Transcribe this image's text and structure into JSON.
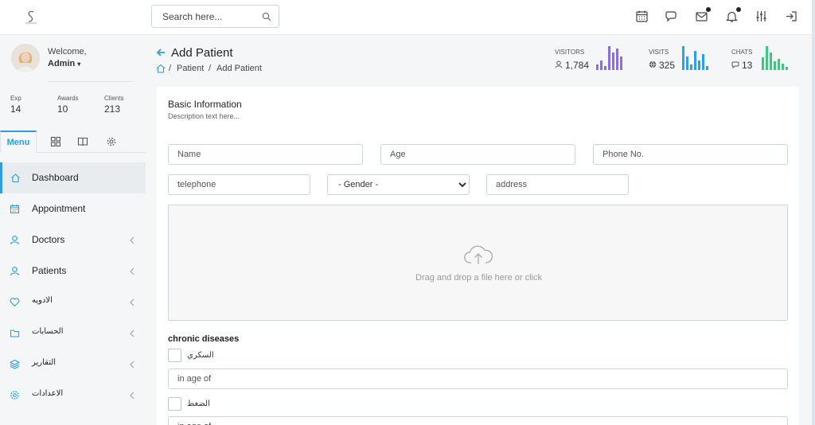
{
  "header": {
    "search_placeholder": "Search here...",
    "icons": [
      "calendar-icon",
      "chat-icon",
      "mail-icon",
      "bell-icon",
      "sliders-icon",
      "logout-icon"
    ]
  },
  "profile": {
    "welcome": "Welcome,",
    "name": "Admin",
    "caret": "▾",
    "stats": [
      {
        "label": "Exp",
        "value": "14"
      },
      {
        "label": "Awards",
        "value": "10"
      },
      {
        "label": "Clients",
        "value": "213"
      }
    ]
  },
  "sidebar": {
    "tab_menu": "Menu",
    "items": [
      {
        "label": "Dashboard",
        "icon": "home-icon",
        "active": true
      },
      {
        "label": "Appointment",
        "icon": "calendar-icon"
      },
      {
        "label": "Doctors",
        "icon": "user-icon"
      },
      {
        "label": "Patients",
        "icon": "user-icon"
      },
      {
        "label": "الادويه",
        "icon": "heart-icon"
      },
      {
        "label": "الحسابات",
        "icon": "folder-icon"
      },
      {
        "label": "التقارير",
        "icon": "layers-icon"
      },
      {
        "label": "الاعدادات",
        "icon": "gear-icon"
      }
    ]
  },
  "page": {
    "title": "Add Patient",
    "breadcrumb": {
      "sep": "/",
      "parent": "Patient",
      "current": "Add Patient"
    },
    "stats": [
      {
        "label": "VISITORS",
        "value": "1,784",
        "color": "#8a6de0"
      },
      {
        "label": "VISITS",
        "value": "325",
        "color": "#2f9fe8"
      },
      {
        "label": "CHATS",
        "value": "13",
        "color": "#3cc783"
      }
    ]
  },
  "form": {
    "title": "Basic Information",
    "description": "Description text here...",
    "name_placeholder": "Name",
    "age_placeholder": "Age",
    "phone_placeholder": "Phone No.",
    "telephone_placeholder": "telephone",
    "gender_selected": "- Gender -",
    "address_placeholder": "address",
    "dropzone_text": "Drag and drop a file here or click",
    "chronic_label": "chronic diseases",
    "diabetes_label": "السكري",
    "age_of_placeholder": "in age of",
    "pressure_label": "الضغط"
  }
}
